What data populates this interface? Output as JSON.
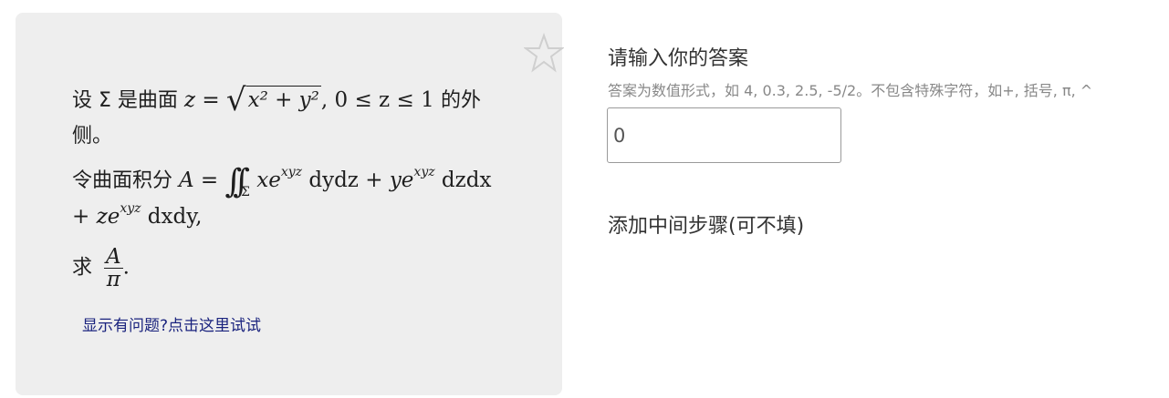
{
  "problem": {
    "line1_prefix": "设 Σ 是曲面 ",
    "line1_math_z": "z",
    "line1_math_eq": " = ",
    "line1_sqrt": "x² + y²",
    "line1_range": ", 0 ≤ z ≤ 1 ",
    "line1_suffix": "的外",
    "line2": "侧。",
    "line3_prefix": "令曲面积分 ",
    "line3_A": "A",
    "line3_eq": " = ",
    "line3_iint": "∫∫",
    "line3_sub": "Σ",
    "line3_term1": "xe",
    "line3_exp1": "xyz",
    "line3_d1": " dydz + ",
    "line3_term2": "ye",
    "line3_exp2": "xyz",
    "line3_d2": " dzdx",
    "line4_term": "+ ze",
    "line4_exp": "xyz",
    "line4_d": " dxdy,",
    "line5_prefix": "求 ",
    "line5_num": "A",
    "line5_den": "π",
    "line5_suffix": ".",
    "help_link": "显示有问题?点击这里试试"
  },
  "answer": {
    "title": "请输入你的答案",
    "hint": "答案为数值形式，如 4, 0.3, 2.5, -5/2。不包含特殊字符，如+, 括号, π, ^",
    "value": "0",
    "steps_label": "添加中间步骤(可不填)"
  },
  "icons": {
    "favorite": "star-outline-icon"
  }
}
